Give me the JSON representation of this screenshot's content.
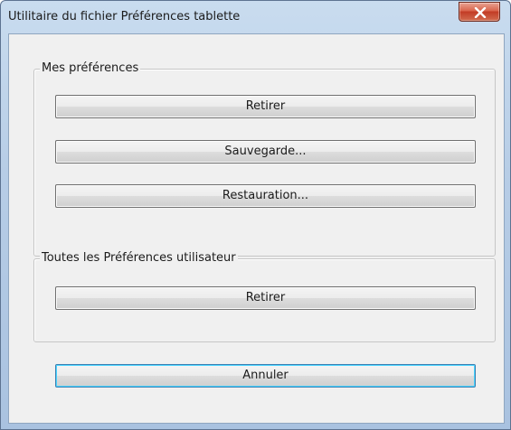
{
  "window": {
    "title": "Utilitaire du fichier Préférences tablette",
    "close_icon": "close-icon"
  },
  "my_preferences": {
    "label": "Mes préférences",
    "remove_button": "Retirer",
    "backup_button": "Sauvegarde...",
    "restore_button": "Restauration..."
  },
  "all_user_preferences": {
    "label": "Toutes les Préférences utilisateur",
    "remove_button": "Retirer"
  },
  "cancel_button": "Annuler",
  "colors": {
    "close_button": "#c23c25",
    "title_bar": "#b7cde6",
    "client_background": "#f0f0f0"
  }
}
